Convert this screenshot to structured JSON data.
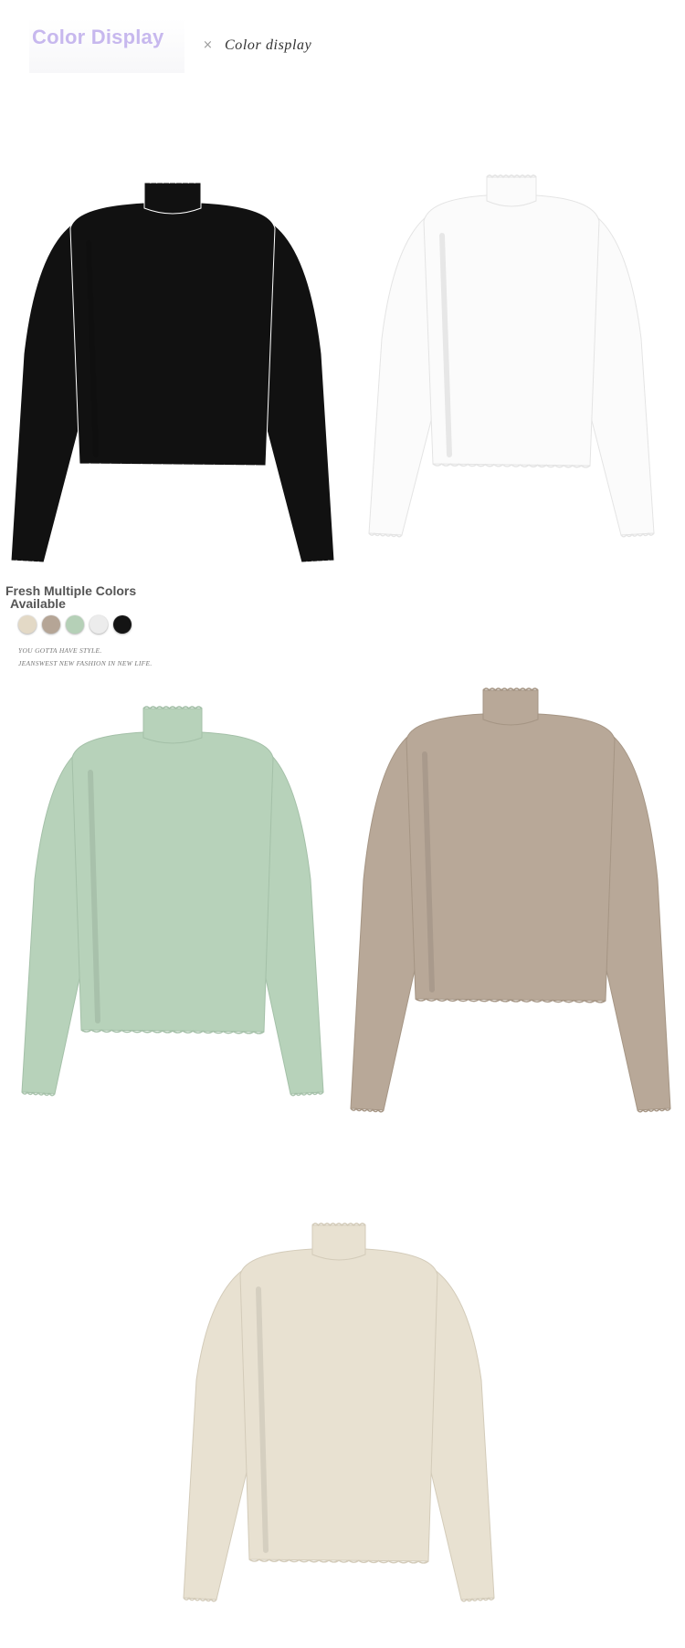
{
  "header": {
    "title": "Color Display",
    "separator": "×",
    "subtitle": "Color display"
  },
  "colors_panel": {
    "title_line1": "Fresh Multiple Colors",
    "title_line2": "Available",
    "swatches": [
      {
        "name": "apricot-swatch",
        "color": "#e3d9c6"
      },
      {
        "name": "khaki-swatch",
        "color": "#b5a596"
      },
      {
        "name": "mint-swatch",
        "color": "#b5d0b7"
      },
      {
        "name": "white-swatch",
        "color": "#ececec"
      },
      {
        "name": "black-swatch",
        "color": "#141414"
      }
    ],
    "tagline_1": "YOU GOTTA HAVE STYLE.",
    "tagline_2": "JEANSWEST NEW FASHION IN NEW LIFE."
  },
  "products": [
    {
      "name": "black-turtleneck",
      "color": "#111111",
      "edge": "#ffffff"
    },
    {
      "name": "white-turtleneck",
      "color": "#fbfbfb",
      "edge": "#e4e4e4"
    },
    {
      "name": "mint-turtleneck",
      "color": "#b7d2ba",
      "edge": "#a4c0a8"
    },
    {
      "name": "khaki-turtleneck",
      "color": "#b8a898",
      "edge": "#a59584"
    },
    {
      "name": "apricot-turtleneck",
      "color": "#e8e1d1",
      "edge": "#d3cbb9"
    }
  ]
}
